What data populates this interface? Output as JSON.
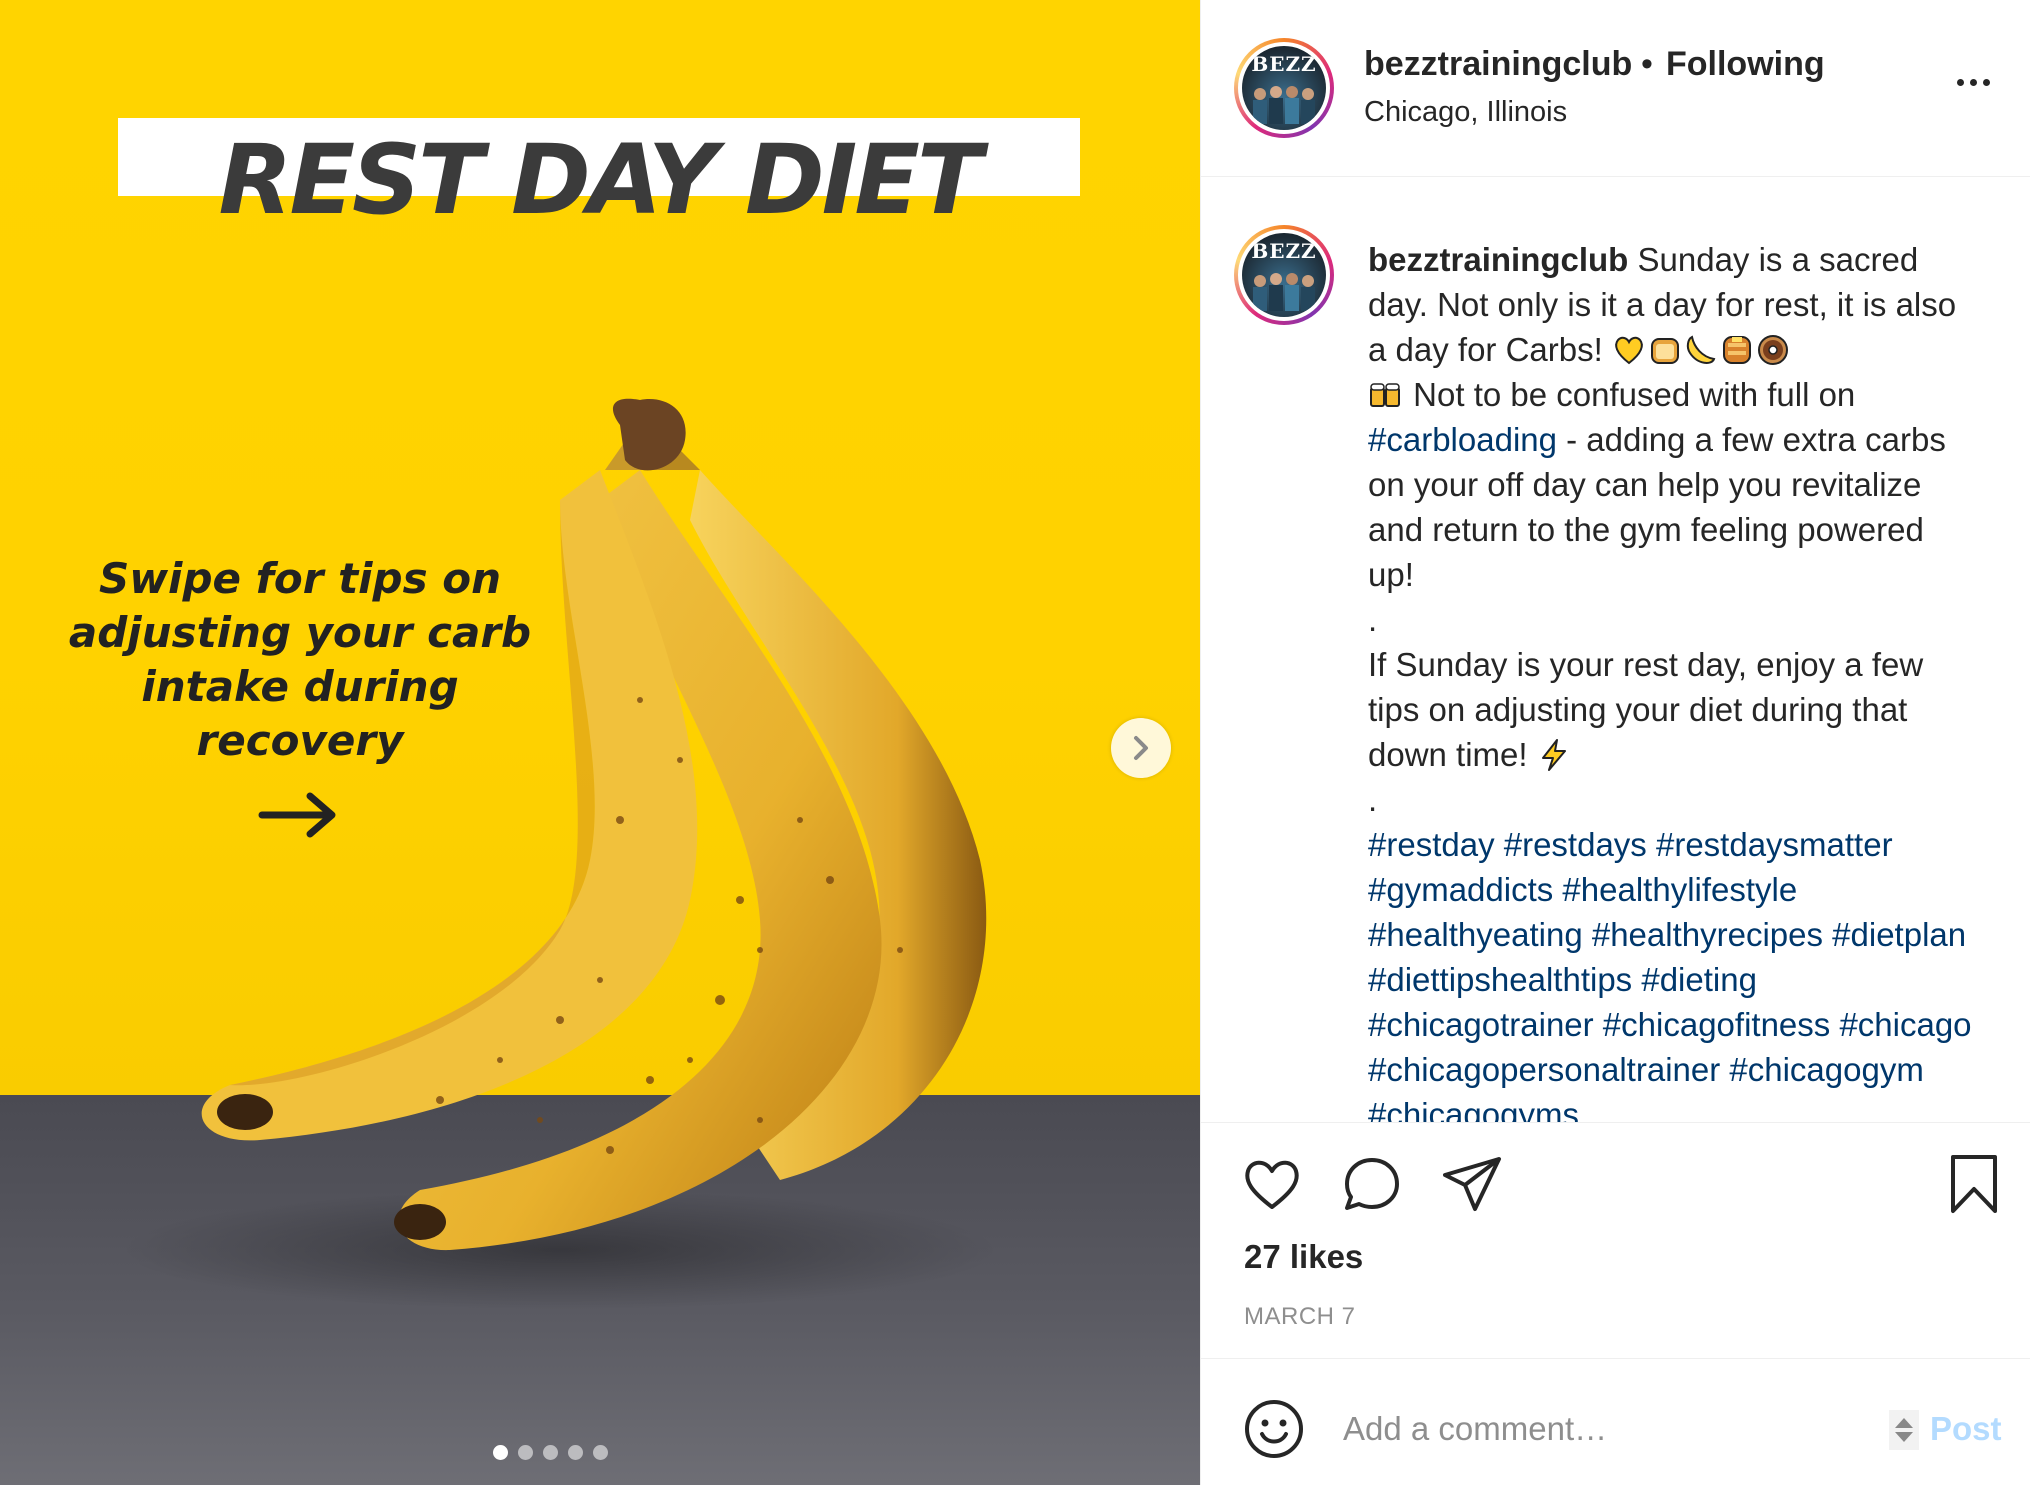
{
  "post_media": {
    "title": "REST DAY DIET",
    "subtitle_lines": [
      "Swipe for tips on",
      "adjusting your carb",
      "intake during",
      "recovery"
    ],
    "carousel": {
      "total": 5,
      "active": 1
    },
    "colors": {
      "background": "#ffd500",
      "table": "#55555c",
      "title_text": "#3b3b3b"
    }
  },
  "header": {
    "avatar_text": "BEZZ",
    "username": "bezztrainingclub",
    "separator": "•",
    "follow_status": "Following",
    "location": "Chicago, Illinois"
  },
  "caption": {
    "avatar_text": "BEZZ",
    "username": "bezztrainingclub",
    "intro": " Sunday is a sacred day. Not only is it a day for rest, it is also a day for Carbs! ",
    "intro_emojis": [
      "yellow-heart",
      "bread",
      "banana",
      "pancakes",
      "doughnut"
    ],
    "line2_emoji": "beer-mugs",
    "line2_text": " Not to be confused with full on ",
    "hashtag_carbloading": "#carbloading",
    "line2_rest": " - adding a few extra carbs on your off day can help you revitalize and return to the gym feeling powered up!",
    "dot1": ".",
    "para2": "If Sunday is your rest day, enjoy a few tips on adjusting your diet during that down time! ",
    "para2_emoji": "high-voltage",
    "dot2": ".",
    "hashtags": "#restday #restdays #restdaysmatter #gymaddicts #healthylifestyle #healthyeating #healthyrecipes #dietplan #diettipshealthtips #dieting #chicagotrainer #chicagofitness #chicago #chicagopersonaltrainer #chicagogym #chicagogyms"
  },
  "actions": {
    "icons": [
      "heart-icon",
      "comment-icon",
      "share-icon",
      "bookmark-icon"
    ],
    "likes": "27 likes",
    "date": "MARCH 7"
  },
  "comment": {
    "placeholder": "Add a comment…",
    "post_label": "Post",
    "colors": {
      "post_disabled": "#b3dbff",
      "hashtag": "#00376b"
    }
  }
}
